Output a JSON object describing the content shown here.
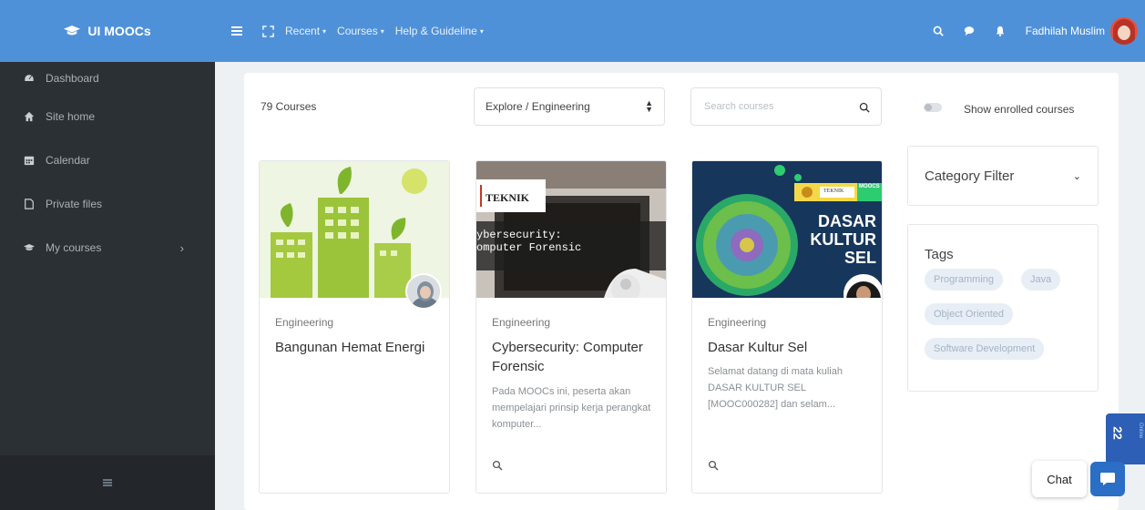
{
  "brand": {
    "name": "UI MOOCs"
  },
  "topnav": {
    "links": [
      "Recent",
      "Courses",
      "Help & Guideline"
    ],
    "user_name": "Fadhilah Muslim"
  },
  "sidebar": {
    "items": [
      {
        "label": "Dashboard",
        "icon": "dashboard-icon"
      },
      {
        "label": "Site home",
        "icon": "home-icon"
      },
      {
        "label": "Calendar",
        "icon": "calendar-icon"
      },
      {
        "label": "Private files",
        "icon": "file-icon"
      },
      {
        "label": "My courses",
        "icon": "graduation-cap-icon"
      }
    ]
  },
  "toolbar": {
    "count_label": "79 Courses",
    "category_selected": "Explore / Engineering",
    "search_placeholder": "Search courses",
    "toggle_label": "Show enrolled courses"
  },
  "courses": [
    {
      "category": "Engineering",
      "title": "Bangunan Hemat Energi",
      "description": ""
    },
    {
      "category": "Engineering",
      "title": "Cybersecurity: Computer Forensic",
      "description": "Pada MOOCs ini, peserta akan mempelajari prinsip kerja perangkat komputer...",
      "image_text": {
        "brand": "TEKNIK",
        "line1": "ybersecurity:",
        "line2": "omputer Forensic"
      }
    },
    {
      "category": "Engineering",
      "title": "Dasar Kultur Sel",
      "description": "Selamat datang di mata kuliah DASAR KULTUR SEL [MOOC000282] dan selam...",
      "image_text": {
        "brand": "TEKNIK",
        "tag": "MOOCS",
        "line1": "DASAR",
        "line2": "KULTUR",
        "line3": "SEL"
      }
    }
  ],
  "filters": {
    "category_label": "Category Filter",
    "tags_title": "Tags",
    "tags": [
      "Programming",
      "Java",
      "Object Oriented",
      "Software Development"
    ]
  },
  "widgets": {
    "side_badge_number": "22",
    "side_badge_text": "Online",
    "chat_label": "Chat"
  },
  "colors": {
    "topbar": "#4f91d9",
    "sidebar": "#2b3035",
    "accent": "#2a6ec6",
    "tag_bg": "#e8eef5"
  }
}
